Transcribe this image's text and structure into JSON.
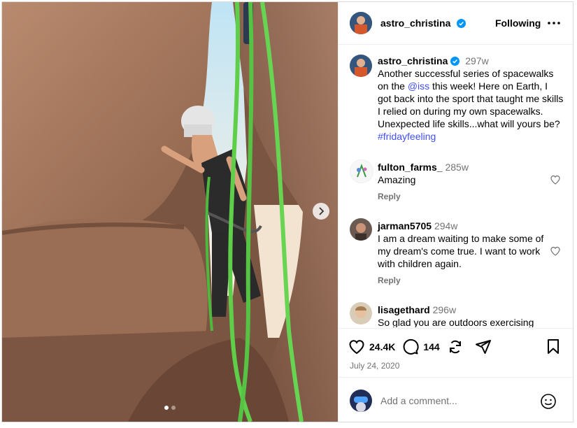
{
  "post": {
    "author": "astro_christina",
    "follow_label": "Following",
    "caption_time": "297w",
    "caption_text_1": "Another successful series of spacewalks on the ",
    "caption_mention": "@iss",
    "caption_text_2": " this week! Here on Earth, I got back into the sport that taught me skills I relied on during my own spacewalks. Unexpected life skills...what will yours be? ",
    "caption_hashtag": "#fridayfeeling"
  },
  "comments": [
    {
      "user": "fulton_farms_",
      "time": "285w",
      "text": "Amazing",
      "reply": "Reply"
    },
    {
      "user": "jarman5705",
      "time": "294w",
      "text": "I am a dream waiting to make some of my dream's come true. I want to work with children again.",
      "reply": "Reply"
    },
    {
      "user": "lisagethard",
      "time": "296w",
      "text": "So glad you are outdoors exercising"
    }
  ],
  "stats": {
    "likes": "24.4K",
    "comments": "144",
    "date": "July 24, 2020"
  },
  "add_comment": {
    "placeholder": "Add a comment..."
  },
  "carousel": {
    "slide_count": 2,
    "active_index": 0
  },
  "icons": [
    "verified-icon",
    "more-icon",
    "heart-icon",
    "comment-icon",
    "share-icon",
    "send-icon",
    "bookmark-icon",
    "emoji-icon",
    "chevron-right-icon"
  ],
  "colors": {
    "link": "#4150f7",
    "verified": "#0095f6",
    "muted": "#737373",
    "rope": "#5fcf4a"
  }
}
